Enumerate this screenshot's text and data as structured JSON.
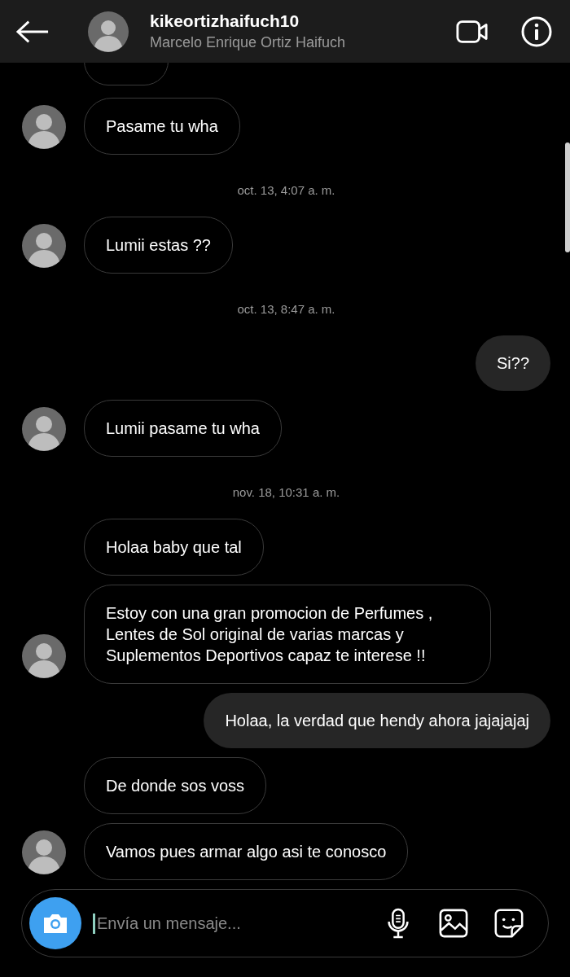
{
  "header": {
    "username": "kikeortizhaifuch10",
    "full_name": "Marcelo Enrique Ortiz Haifuch"
  },
  "messages": [
    {
      "kind": "clipped"
    },
    {
      "kind": "incoming",
      "text": "Pasame tu wha",
      "avatar": true
    },
    {
      "kind": "timestamp",
      "text": "oct. 13, 4:07 a. m."
    },
    {
      "kind": "incoming",
      "text": "Lumii estas ??",
      "avatar": true
    },
    {
      "kind": "timestamp",
      "text": "oct. 13, 8:47 a. m."
    },
    {
      "kind": "outgoing",
      "text": "Si??"
    },
    {
      "kind": "incoming",
      "text": "Lumii pasame tu wha",
      "avatar": true
    },
    {
      "kind": "timestamp",
      "text": "nov. 18, 10:31 a. m."
    },
    {
      "kind": "incoming",
      "text": "Holaa baby que tal",
      "avatar": false
    },
    {
      "kind": "incoming",
      "text": "Estoy con una gran promocion de Perfumes , Lentes de Sol original de varias marcas y Suplementos Deportivos capaz te interese !!",
      "avatar": true
    },
    {
      "kind": "outgoing",
      "text": "Holaa, la verdad que hendy ahora jajajajaj"
    },
    {
      "kind": "incoming",
      "text": "De donde sos voss",
      "avatar": false
    },
    {
      "kind": "incoming",
      "text": "Vamos pues armar algo asi te conosco",
      "avatar": true
    }
  ],
  "composer": {
    "placeholder": "Envía un mensaje..."
  }
}
